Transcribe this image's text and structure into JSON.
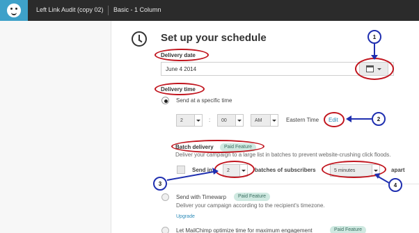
{
  "topbar": {
    "campaign_name": "Left Link Audit (copy 02)",
    "template_name": "Basic - 1 Column"
  },
  "heading": {
    "title": "Set up your schedule"
  },
  "delivery_date": {
    "label": "Delivery date",
    "value": "June 4 2014"
  },
  "delivery_time": {
    "label": "Delivery time",
    "option_specific": "Send at a specific time",
    "hour": "2",
    "minute": "00",
    "ampm": "AM",
    "timezone": "Eastern Time",
    "edit_link": "Edit"
  },
  "batch": {
    "title": "Batch delivery",
    "badge": "Paid Feature",
    "description": "Deliver your campaign to a large list in batches to prevent website-crushing click floods.",
    "send_in": "Send in",
    "count": "2",
    "batches_label": "batches of subscribers",
    "interval": "5 minutes",
    "apart": "apart"
  },
  "timewarp": {
    "label": "Send with Timewarp",
    "badge": "Paid Feature",
    "description": "Deliver your campaign according to the recipient's timezone.",
    "upgrade_link": "Upgrade"
  },
  "optimize": {
    "label": "Let MailChimp optimize time for maximum engagement",
    "badge": "Paid Feature"
  },
  "callouts": [
    "1",
    "2",
    "3",
    "4"
  ],
  "colors": {
    "topbar": "#2b2b2b",
    "logo_bg": "#3ea1c9",
    "highlight_ellipse": "#c1151e",
    "callout_blue": "#1f2fb0",
    "link": "#2a8ab8",
    "badge_bg": "#cfe9e1"
  },
  "icons": {
    "logo": "freddie-logo-icon",
    "clock": "clock-icon",
    "calendar": "calendar-icon"
  }
}
